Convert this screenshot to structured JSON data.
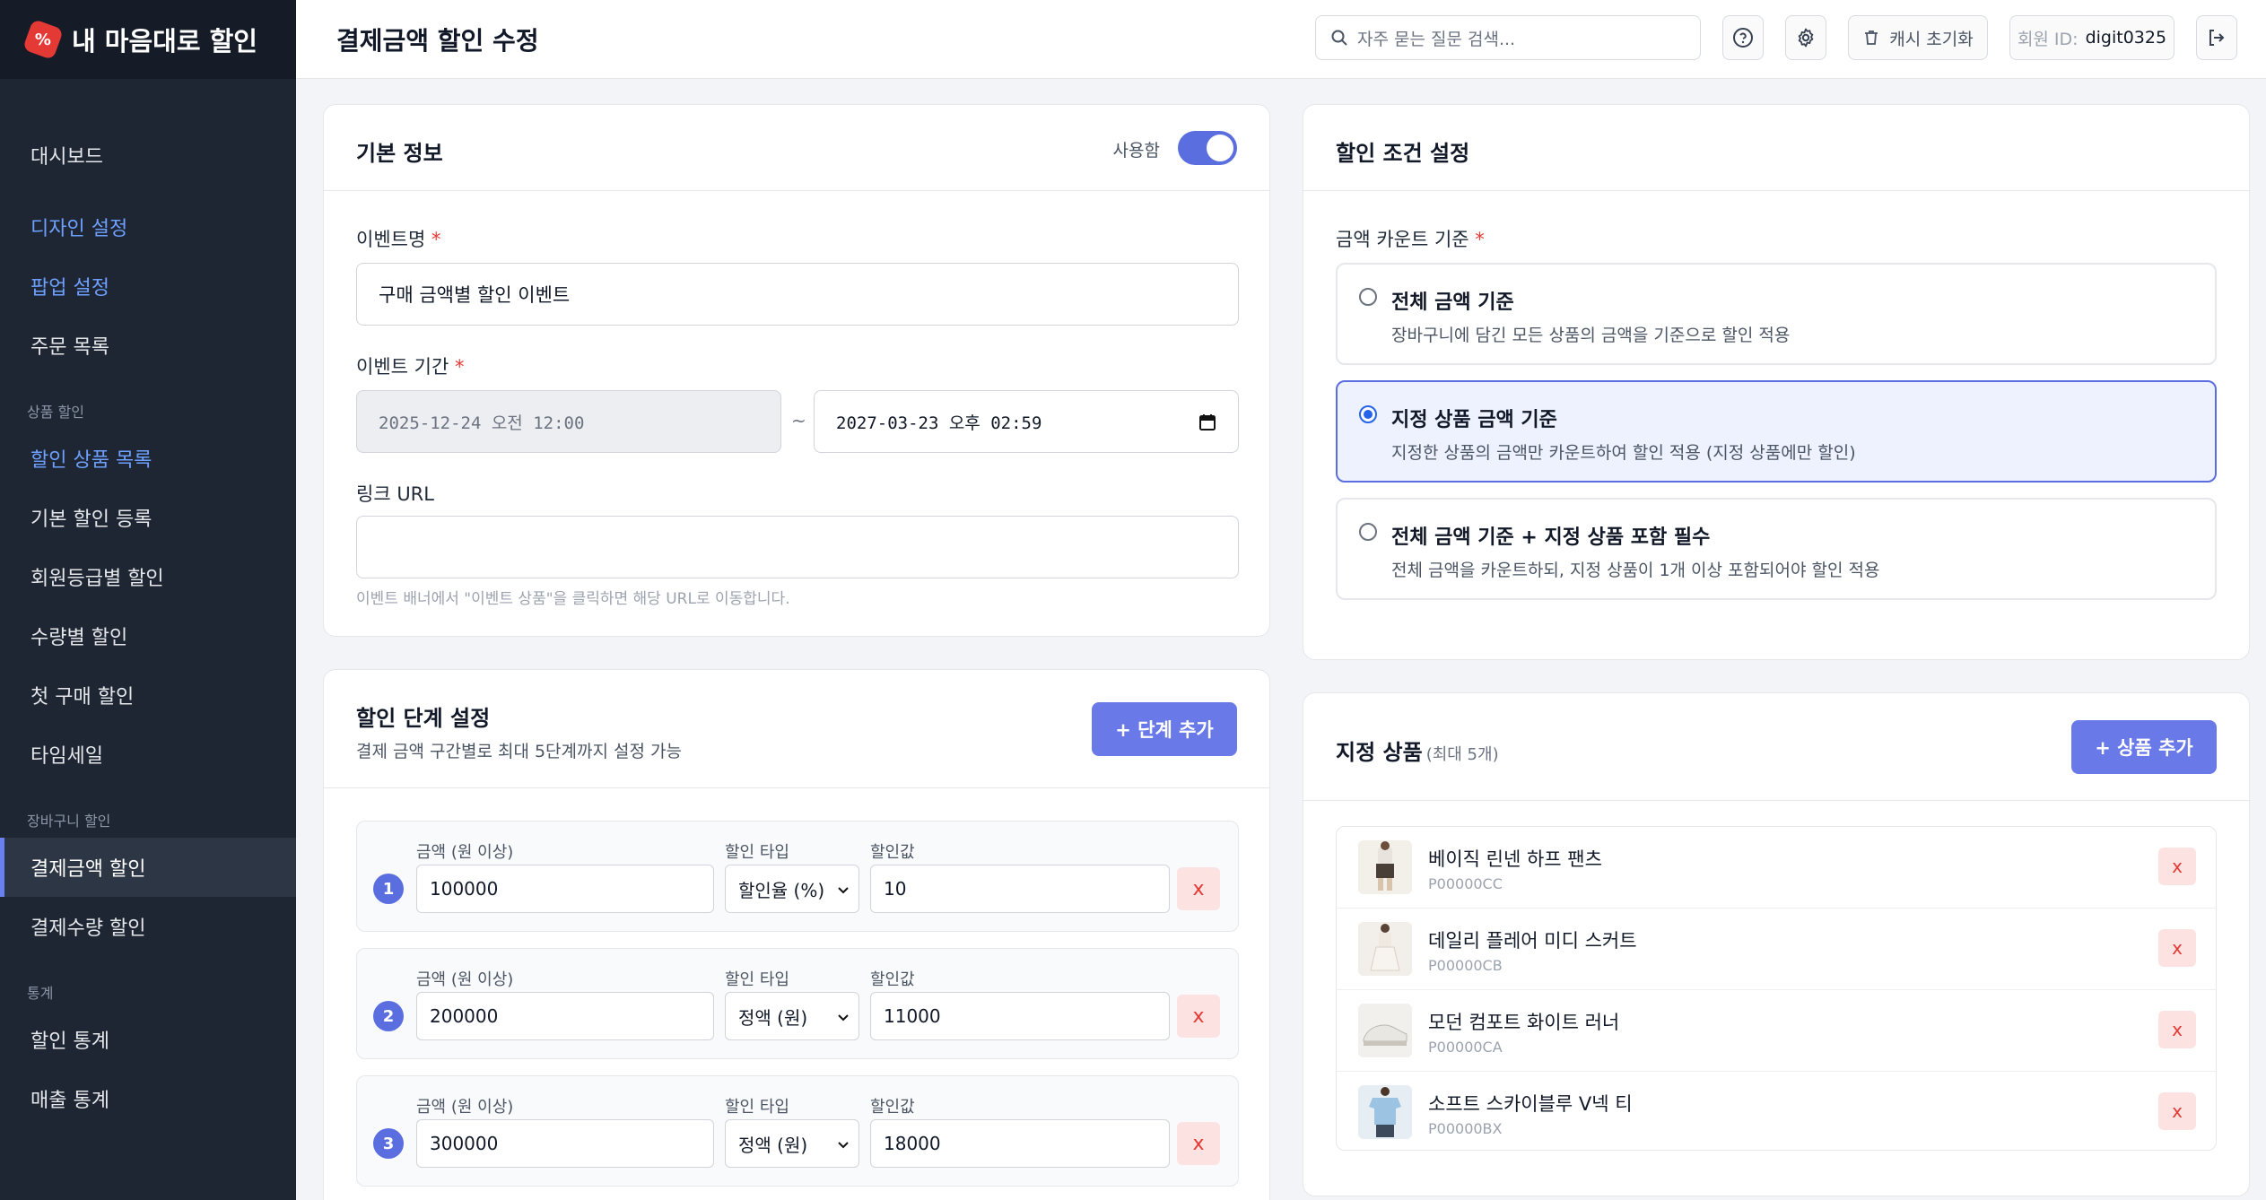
{
  "brand": {
    "title": "내 마음대로 할인",
    "logo_mark": "%"
  },
  "sidebar": {
    "items": [
      {
        "label": "대시보드"
      },
      {
        "label": "디자인 설정"
      },
      {
        "label": "팝업 설정"
      },
      {
        "label": "주문 목록"
      }
    ],
    "section_product": "상품 할인",
    "product_items": [
      {
        "label": "할인 상품 목록"
      },
      {
        "label": "기본 할인 등록"
      },
      {
        "label": "회원등급별 할인"
      },
      {
        "label": "수량별 할인"
      },
      {
        "label": "첫 구매 할인"
      },
      {
        "label": "타임세일"
      }
    ],
    "section_cart": "장바구니 할인",
    "cart_items": [
      {
        "label": "결제금액 할인"
      },
      {
        "label": "결제수량 할인"
      }
    ],
    "section_stats": "통계",
    "stats_items": [
      {
        "label": "할인 통계"
      },
      {
        "label": "매출 통계"
      }
    ]
  },
  "header": {
    "title": "결제금액 할인 수정",
    "search_placeholder": "자주 묻는 질문 검색...",
    "cache_reset": "캐시 초기화",
    "member_label": "회원 ID:",
    "member_value": "digit0325"
  },
  "basic": {
    "title": "기본 정보",
    "toggle_label": "사용함",
    "toggle_on": true,
    "event_name_label": "이벤트명",
    "required_mark": "*",
    "event_name_value": "구매 금액별 할인 이벤트",
    "period_label": "이벤트 기간",
    "period_start": "2025-12-24 오전 12:00",
    "period_sep": "~",
    "period_end": "2027-03-23 오후 02:59",
    "link_label": "링크 URL",
    "link_value": "",
    "link_hint": "이벤트 배너에서 \"이벤트 상품\"을 클릭하면 해당 URL로 이동합니다."
  },
  "tiers": {
    "title": "할인 단계 설정",
    "subtitle": "결제 금액 구간별로 최대 5단계까지 설정 가능",
    "add_button": "+ 단계 추가",
    "amount_label": "금액 (원 이상)",
    "type_label": "할인 타입",
    "value_label": "할인값",
    "delete_label": "x",
    "rows": [
      {
        "num": "1",
        "amount": "100000",
        "type": "할인율 (%)",
        "value": "10"
      },
      {
        "num": "2",
        "amount": "200000",
        "type": "정액 (원)",
        "value": "11000"
      },
      {
        "num": "3",
        "amount": "300000",
        "type": "정액 (원)",
        "value": "18000"
      }
    ]
  },
  "condition": {
    "title": "할인 조건 설정",
    "count_label": "금액 카운트 기준",
    "options": [
      {
        "title": "전체 금액 기준",
        "desc": "장바구니에 담긴 모든 상품의 금액을 기준으로 할인 적용",
        "selected": false
      },
      {
        "title": "지정 상품 금액 기준",
        "desc": "지정한 상품의 금액만 카운트하여 할인 적용 (지정 상품에만 할인)",
        "selected": true
      },
      {
        "title": "전체 금액 기준 + 지정 상품 포함 필수",
        "desc": "전체 금액을 카운트하되, 지정 상품이 1개 이상 포함되어야 할인 적용",
        "selected": false
      }
    ]
  },
  "products": {
    "title": "지정 상품",
    "title_note": "(최대 5개)",
    "add_button": "+ 상품 추가",
    "delete_label": "x",
    "items": [
      {
        "name": "베이직 린넨 하프 팬츠",
        "code": "P00000CC",
        "color": "#c9b8a6"
      },
      {
        "name": "데일리 플레어 미디 스커트",
        "code": "P00000CB",
        "color": "#e9e2da"
      },
      {
        "name": "모던 컴포트 화이트 러너",
        "code": "P00000CA",
        "color": "#d8d6d1"
      },
      {
        "name": "소프트 스카이블루 V넥 티",
        "code": "P00000BX",
        "color": "#8fb8d8"
      }
    ]
  },
  "colors": {
    "accent": "#5b6ee0",
    "danger": "#e53935",
    "sidebar": "#1e2633"
  }
}
